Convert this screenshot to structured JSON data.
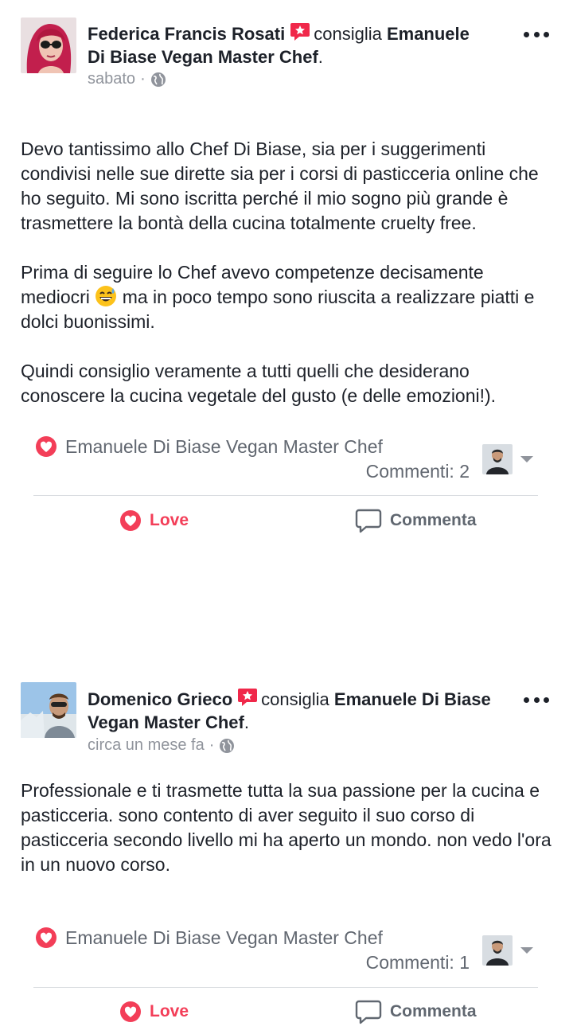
{
  "posts": [
    {
      "author": "Federica Francis Rosati",
      "verb": "consiglia",
      "page_name_part1": "Emanuele",
      "page_name_part2": "Di Biase Vegan Master Chef",
      "period": ".",
      "time": "sabato",
      "separator": "·",
      "paragraphs": [
        "Devo tantissimo allo Chef Di Biase, sia per i suggerimenti condivisi nelle sue dirette sia per i corsi di pasticceria online che ho seguito. Mi sono iscritta perché il mio sogno più grande è trasmettere la bontà della cucina totalmente cruelty free.",
        "Prima di seguire lo Chef avevo competenze decisamente",
        "mediocri",
        "ma in poco tempo sono riuscita a realizzare piatti e dolci buonissimi.",
        "Quindi consiglio veramente a tutti quelli che desiderano conoscere la cucina vegetale del gusto (e delle emozioni!)."
      ],
      "reaction_by": "Emanuele Di Biase Vegan Master Chef",
      "comments": "Commenti: 2",
      "love_label": "Love",
      "comment_label": "Commenta"
    },
    {
      "author": "Domenico Grieco",
      "verb": "consiglia",
      "page_name_part1": "Emanuele Di Biase",
      "page_name_part2": "Vegan Master Chef",
      "period": ".",
      "time": "circa un mese fa",
      "separator": "·",
      "body": "Professionale e ti trasmette tutta la sua passione per la cucina e pasticceria. sono contento di aver seguito il suo corso di pasticceria secondo livello mi ha aperto un mondo. non vedo l'ora in un nuovo corso.",
      "reaction_by": "Emanuele Di Biase Vegan Master Chef",
      "comments": "Commenti: 1",
      "love_label": "Love",
      "comment_label": "Commenta"
    }
  ],
  "colors": {
    "love": "#f33e58",
    "text": "#1d2129",
    "meta": "#90949c"
  }
}
